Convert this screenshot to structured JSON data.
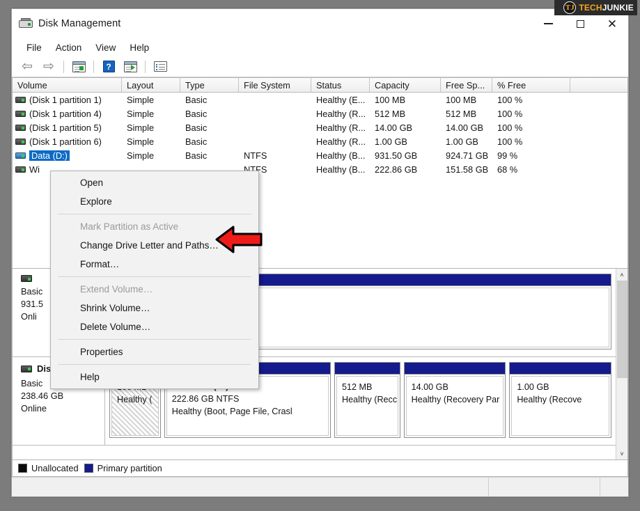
{
  "window": {
    "title": "Disk Management",
    "icon": "disk-drive-icon",
    "controls": {
      "minimize": "─",
      "maximize": "□",
      "close": "✕"
    }
  },
  "menubar": {
    "items": [
      {
        "label": "File"
      },
      {
        "label": "Action"
      },
      {
        "label": "View"
      },
      {
        "label": "Help"
      }
    ]
  },
  "toolbar": {
    "buttons": [
      {
        "name": "back-button",
        "icon": "left-arrow-icon",
        "glyph": "⇦"
      },
      {
        "name": "forward-button",
        "icon": "right-arrow-icon",
        "glyph": "⇨"
      },
      {
        "name": "show-console-tree-button",
        "icon": "window-green-icon"
      },
      {
        "name": "help-button",
        "icon": "question-mark-icon",
        "glyph": "?"
      },
      {
        "name": "action-menu-button",
        "icon": "window-play-icon"
      },
      {
        "name": "properties-button",
        "icon": "properties-list-icon"
      }
    ]
  },
  "volume_list": {
    "columns": [
      {
        "label": "Volume"
      },
      {
        "label": "Layout"
      },
      {
        "label": "Type"
      },
      {
        "label": "File System"
      },
      {
        "label": "Status"
      },
      {
        "label": "Capacity"
      },
      {
        "label": "Free Sp..."
      },
      {
        "label": "% Free"
      }
    ],
    "rows": [
      {
        "volume": "(Disk 1 partition 1)",
        "layout": "Simple",
        "type": "Basic",
        "file_system": "",
        "status": "Healthy (E...",
        "capacity": "100 MB",
        "free_space": "100 MB",
        "percent_free": "100 %",
        "selected": false
      },
      {
        "volume": "(Disk 1 partition 4)",
        "layout": "Simple",
        "type": "Basic",
        "file_system": "",
        "status": "Healthy (R...",
        "capacity": "512 MB",
        "free_space": "512 MB",
        "percent_free": "100 %",
        "selected": false
      },
      {
        "volume": "(Disk 1 partition 5)",
        "layout": "Simple",
        "type": "Basic",
        "file_system": "",
        "status": "Healthy (R...",
        "capacity": "14.00 GB",
        "free_space": "14.00 GB",
        "percent_free": "100 %",
        "selected": false
      },
      {
        "volume": "(Disk 1 partition 6)",
        "layout": "Simple",
        "type": "Basic",
        "file_system": "",
        "status": "Healthy (R...",
        "capacity": "1.00 GB",
        "free_space": "1.00 GB",
        "percent_free": "100 %",
        "selected": false
      },
      {
        "volume": "Data (D:)",
        "layout": "Simple",
        "type": "Basic",
        "file_system": "NTFS",
        "status": "Healthy (B...",
        "capacity": "931.50 GB",
        "free_space": "924.71 GB",
        "percent_free": "99 %",
        "selected": true
      },
      {
        "volume": "Wi",
        "layout": "",
        "type": "",
        "file_system": "NTFS",
        "status": "Healthy (B...",
        "capacity": "222.86 GB",
        "free_space": "151.58 GB",
        "percent_free": "68 %",
        "selected": false
      }
    ]
  },
  "context_menu": {
    "items": [
      {
        "label": "Open",
        "disabled": false
      },
      {
        "label": "Explore",
        "disabled": false
      },
      {
        "separator": true
      },
      {
        "label": "Mark Partition as Active",
        "disabled": true
      },
      {
        "label": "Change Drive Letter and Paths…",
        "disabled": false
      },
      {
        "label": "Format…",
        "disabled": false
      },
      {
        "separator": true
      },
      {
        "label": "Extend Volume…",
        "disabled": true
      },
      {
        "label": "Shrink Volume…",
        "disabled": false
      },
      {
        "label": "Delete Volume…",
        "disabled": false
      },
      {
        "separator": true
      },
      {
        "label": "Properties",
        "disabled": false
      },
      {
        "separator": true
      },
      {
        "label": "Help",
        "disabled": false
      }
    ]
  },
  "annotation": {
    "arrow_color": "#ee1c18",
    "arrow_outline": "#000000",
    "points_at": "Change Drive Letter and Paths…"
  },
  "disks": [
    {
      "name": "",
      "type": "Basic",
      "size": "931.5",
      "status": "Onli",
      "partitions": [
        {
          "title": "",
          "size_line": "",
          "status_line": "",
          "style": "blank",
          "flex": 1
        }
      ]
    },
    {
      "name": "Disk 1",
      "type": "Basic",
      "size": "238.46 GB",
      "status": "Online",
      "partitions": [
        {
          "title": "",
          "size_line": "100 MB",
          "status_line": "Healthy (",
          "style": "hatched",
          "flex": 0.62
        },
        {
          "title": "Windows  (C:)",
          "size_line": "222.86 GB NTFS",
          "status_line": "Healthy (Boot, Page File, Crasl",
          "style": "normal",
          "flex": 2.05
        },
        {
          "title": "",
          "size_line": "512 MB",
          "status_line": "Healthy (Recc",
          "style": "normal",
          "flex": 0.8
        },
        {
          "title": "",
          "size_line": "14.00 GB",
          "status_line": "Healthy (Recovery Par",
          "style": "normal",
          "flex": 1.25
        },
        {
          "title": "",
          "size_line": "1.00 GB",
          "status_line": "Healthy (Recove",
          "style": "normal",
          "flex": 1.25
        }
      ]
    }
  ],
  "legend": {
    "items": [
      {
        "label": "Unallocated",
        "color": "#0b0b0b"
      },
      {
        "label": "Primary partition",
        "color": "#151a8c"
      }
    ]
  },
  "scrollbar": {
    "up": "˄",
    "down": "˅"
  },
  "watermark": {
    "brand_first": "TECH",
    "brand_second": "JUNKIE",
    "logo_letter": "TJ"
  }
}
